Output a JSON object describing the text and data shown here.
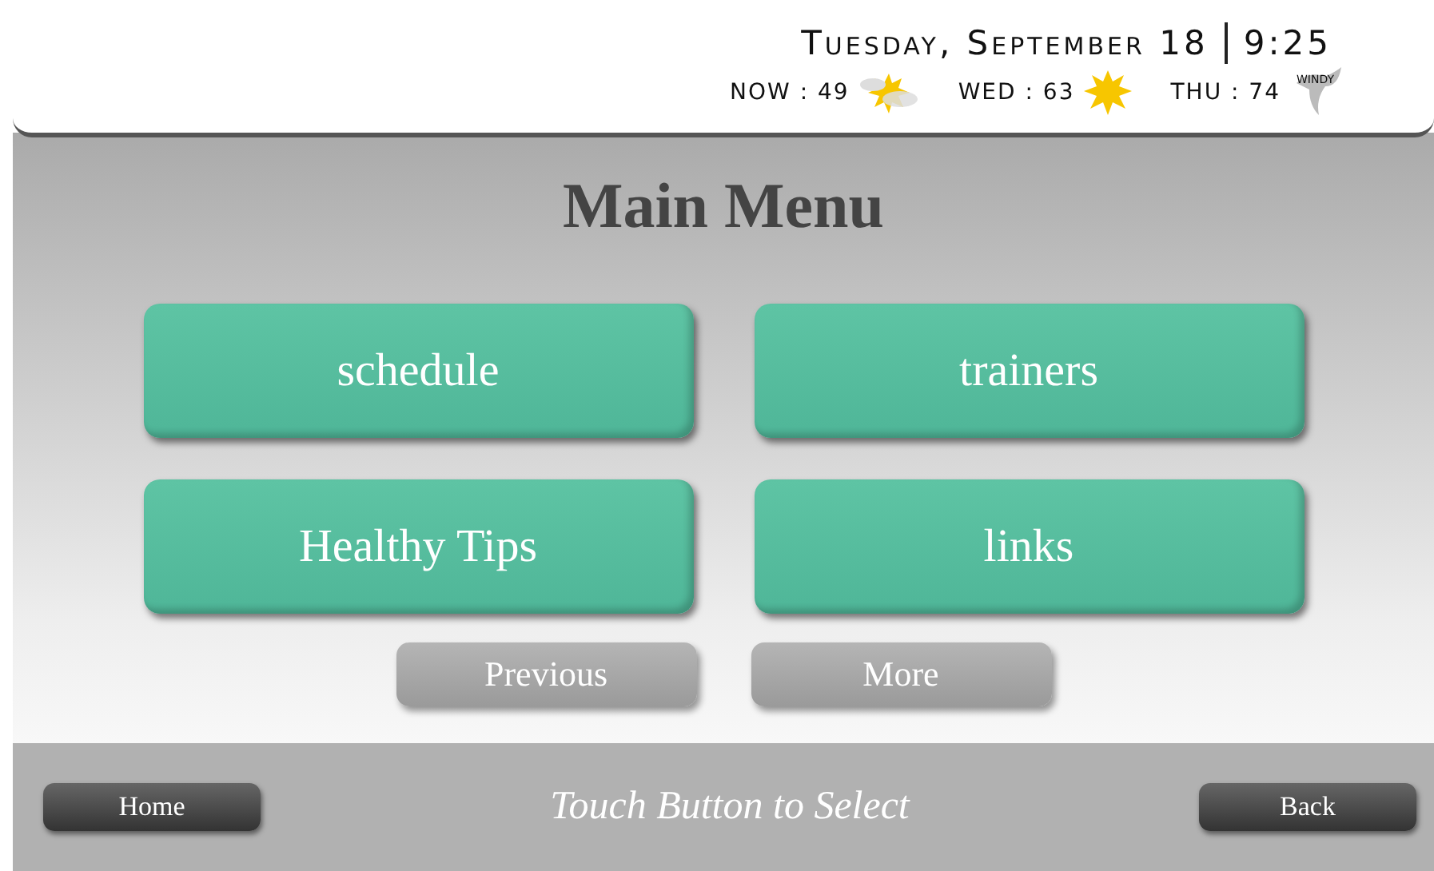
{
  "header": {
    "date": "Tuesday, September 18",
    "time": "9:25",
    "forecast": [
      {
        "label": "NOW : 49",
        "kind": "partly-sunny"
      },
      {
        "label": "WED : 63",
        "kind": "sunny"
      },
      {
        "label": "THU : 74",
        "kind": "windy",
        "icon_text": "WINDY"
      }
    ]
  },
  "title": "Main Menu",
  "menu": [
    "schedule",
    "trainers",
    "Healthy Tips",
    "links"
  ],
  "paging": [
    "Previous",
    "More"
  ],
  "footer": {
    "home": "Home",
    "hint": "Touch Button to Select",
    "back": "Back"
  }
}
